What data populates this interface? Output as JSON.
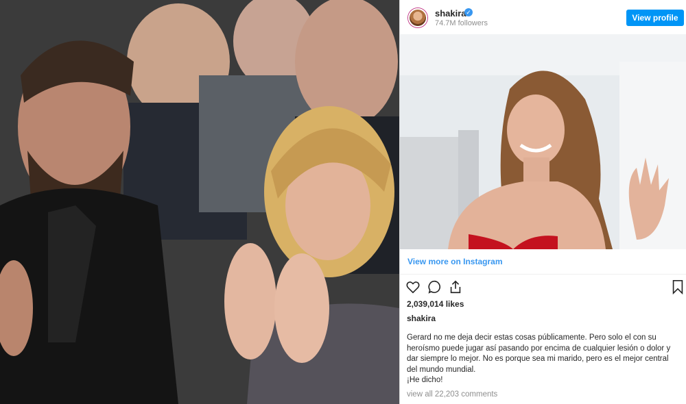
{
  "embed": {
    "username": "shakira",
    "verified_icon": "verified-badge-icon",
    "followers": "74.7M followers",
    "view_profile_label": "View profile",
    "view_more_label": "View more on Instagram",
    "likes": "2,039,014 likes",
    "caption_username": "shakira",
    "caption_line_1": "Gerard no me deja decir estas cosas públicamente. Pero solo el con su heroísmo puede jugar así pasando por encima de cualquier lesión o dolor y dar siempre lo mejor. No es porque sea mi marido, pero es el mejor central del mundo mundial.",
    "caption_line_2": "¡He dicho!",
    "comments_link": "view all 22,203 comments",
    "icons": {
      "like": "heart-icon",
      "comment": "comment-icon",
      "share": "share-icon",
      "save": "bookmark-icon"
    },
    "colors": {
      "accent": "#0095f6",
      "link": "#3897f0",
      "dress": "#c4121f"
    }
  },
  "left_photo": {
    "description_free": true
  }
}
